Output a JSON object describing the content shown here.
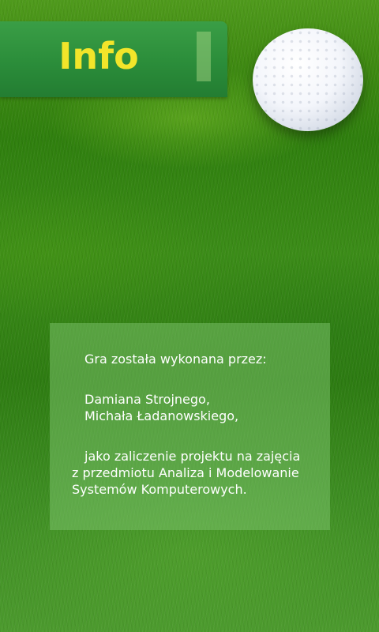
{
  "header": {
    "title": "Info"
  },
  "info": {
    "made_by": "Gra została wykonana przez:",
    "authors": [
      "Damiana Strojnego,",
      "Michała Ładanowskiego,"
    ],
    "description_lines": [
      "jako zaliczenie projektu na zajęcia",
      "z przedmiotu Analiza i Modelowanie",
      "Systemów Komputerowych."
    ]
  },
  "colors": {
    "title": "#f2e52a",
    "banner": "#2b8d3a",
    "grass": "#3b8c18",
    "panel_text": "#ffffff"
  },
  "icons": {
    "ball": "golf-ball-icon"
  }
}
